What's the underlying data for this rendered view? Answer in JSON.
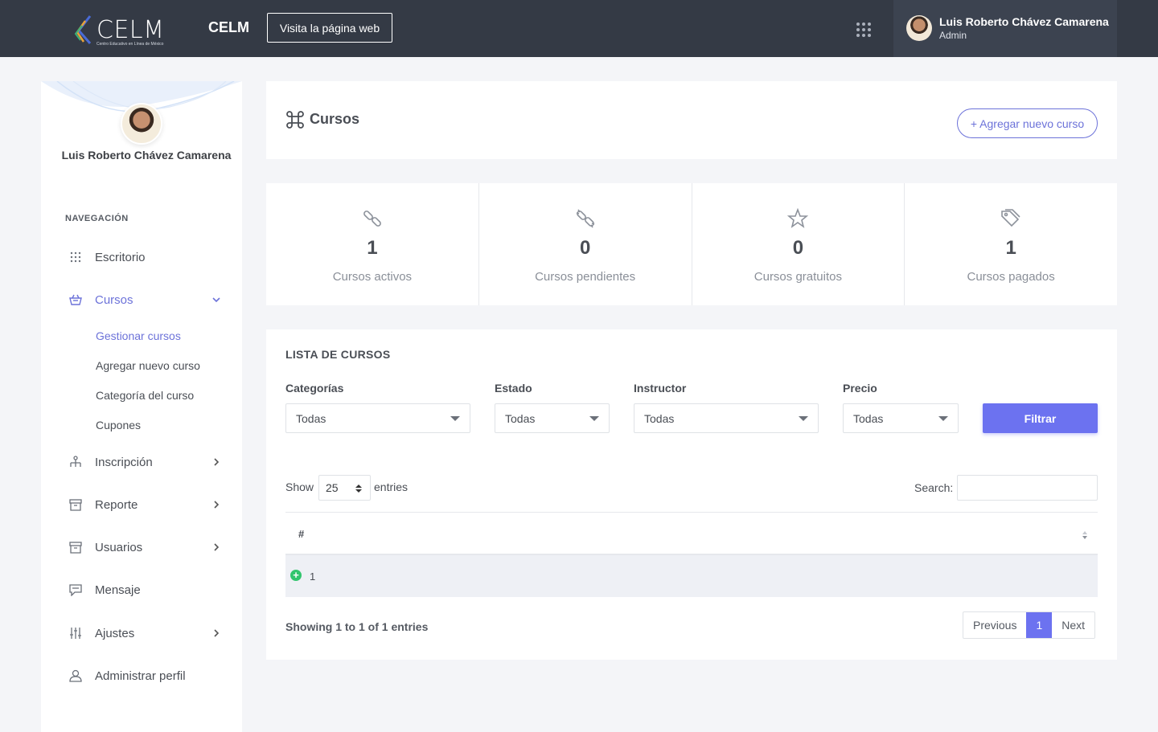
{
  "topbar": {
    "logo_text": "CELM",
    "logo_subtitle": "Centro Educativo en Línea de México",
    "brand": "CELM",
    "visit_button": "Visita la página web",
    "user_name": "Luis Roberto Chávez Camarena",
    "user_role": "Admin"
  },
  "sidebar": {
    "user_name": "Luis Roberto Chávez Camarena",
    "nav_heading": "NAVEGACIÓN",
    "items": [
      {
        "label": "Escritorio",
        "icon": "grid-icon"
      },
      {
        "label": "Cursos",
        "icon": "basket-icon",
        "active": true
      },
      {
        "label": "Inscripción",
        "icon": "hierarchy-icon"
      },
      {
        "label": "Reporte",
        "icon": "archive-icon"
      },
      {
        "label": "Usuarios",
        "icon": "archive-icon"
      },
      {
        "label": "Mensaje",
        "icon": "chat-icon"
      },
      {
        "label": "Ajustes",
        "icon": "sliders-icon"
      },
      {
        "label": "Administrar perfil",
        "icon": "user-icon"
      }
    ],
    "sub_items": [
      "Gestionar cursos",
      "Agregar nuevo curso",
      "Categoría del curso",
      "Cupones"
    ]
  },
  "header": {
    "title": "Cursos",
    "add_button": "+ Agregar nuevo curso"
  },
  "stats": [
    {
      "value": "1",
      "label": "Cursos activos",
      "icon": "link-icon"
    },
    {
      "value": "0",
      "label": "Cursos pendientes",
      "icon": "broken-link-icon"
    },
    {
      "value": "0",
      "label": "Cursos gratuitos",
      "icon": "star-icon"
    },
    {
      "value": "1",
      "label": "Cursos pagados",
      "icon": "tags-icon"
    }
  ],
  "list": {
    "title": "LISTA DE CURSOS",
    "filters": [
      {
        "label": "Categorías",
        "value": "Todas"
      },
      {
        "label": "Estado",
        "value": "Todas"
      },
      {
        "label": "Instructor",
        "value": "Todas"
      },
      {
        "label": "Precio",
        "value": "Todas"
      }
    ],
    "filter_button": "Filtrar",
    "show_label": "Show",
    "entries_value": "25",
    "entries_label": "entries",
    "search_label": "Search:",
    "column_header": "#",
    "rows": [
      {
        "num": "1"
      }
    ],
    "showing": "Showing 1 to 1 of 1 entries",
    "pager": {
      "previous": "Previous",
      "current": "1",
      "next": "Next"
    }
  },
  "colors": {
    "accent": "#6c72f0",
    "topbar": "#343a45",
    "success": "#31c56d"
  }
}
